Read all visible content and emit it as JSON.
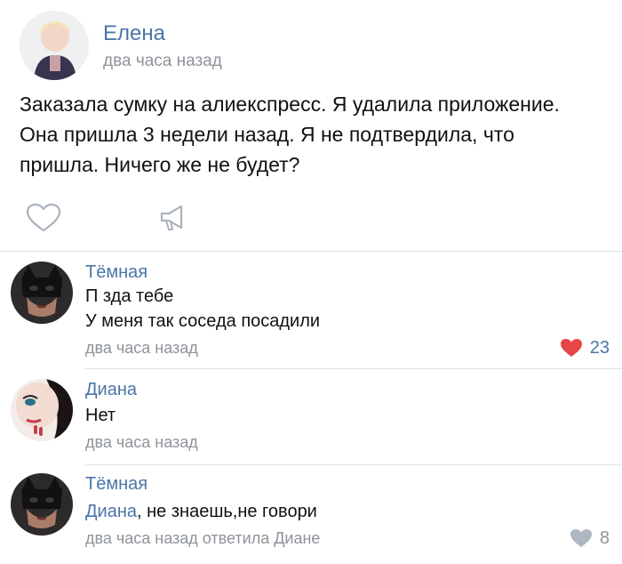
{
  "post": {
    "author": "Елена",
    "time": "два часа назад",
    "text": "Заказала сумку на алиекспресс.  Я удалила приложение. Она пришла 3 недели назад. Я не подтвердила, что пришла. Ничего же не будет?",
    "actions": {
      "like_icon": "heart-outline-icon",
      "share_icon": "megaphone-icon"
    }
  },
  "comments": [
    {
      "author": "Тёмная",
      "line1": "П  зда тебе",
      "line2": "У меня так соседа посадили",
      "time": "два часа назад",
      "likes": "23",
      "liked": true,
      "like_color": "#e64646"
    },
    {
      "author": "Диана",
      "line1": "Нет",
      "time": "два часа назад"
    },
    {
      "author": "Тёмная",
      "mention": "Диана",
      "text_after_mention": ", не знаешь,не говори",
      "time": "два часа назад ответила Диане",
      "likes": "8",
      "liked": false,
      "like_color": "#aeb7c2"
    }
  ],
  "colors": {
    "link": "#4a76a8",
    "muted": "#8e9399",
    "divider": "#dfe2e6"
  }
}
